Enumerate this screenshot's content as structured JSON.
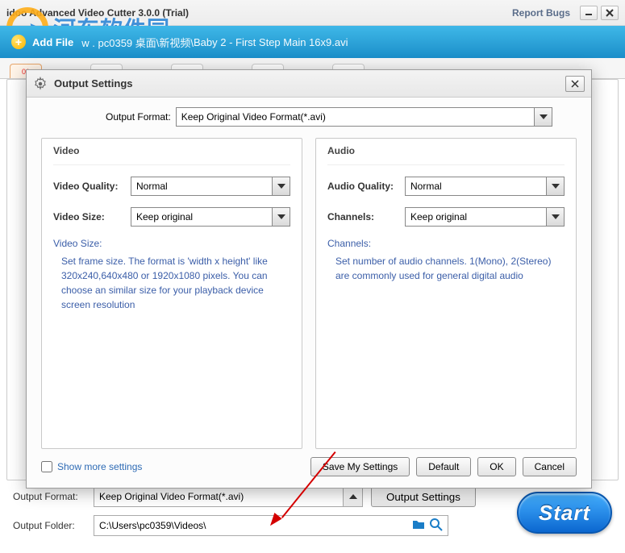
{
  "watermark": "河东软件园",
  "window": {
    "title": "idoo Advanced Video Cutter 3.0.0 (Trial)",
    "report_bugs": "Report Bugs"
  },
  "addfile": {
    "label": "Add File",
    "path_overlay": "w . pc0359 桌面\\新视频\\",
    "path": "Baby 2 - First Step Main 16x9.avi"
  },
  "dialog": {
    "title": "Output Settings",
    "output_format_label": "Output Format:",
    "output_format_value": "Keep Original Video Format(*.avi)",
    "video": {
      "legend": "Video",
      "quality_label": "Video Quality:",
      "quality_value": "Normal",
      "size_label": "Video Size:",
      "size_value": "Keep original",
      "hint_title": "Video Size:",
      "hint_text": "Set frame size. The format is 'width x height' like 320x240,640x480 or 1920x1080 pixels. You can choose an similar size for your playback device screen resolution"
    },
    "audio": {
      "legend": "Audio",
      "quality_label": "Audio Quality:",
      "quality_value": "Normal",
      "channels_label": "Channels:",
      "channels_value": "Keep original",
      "hint_title": "Channels:",
      "hint_text": "Set number of audio channels. 1(Mono), 2(Stereo) are commonly used for general digital audio"
    },
    "show_more": "Show more settings",
    "buttons": {
      "save": "Save My Settings",
      "default": "Default",
      "ok": "OK",
      "cancel": "Cancel"
    }
  },
  "bottom": {
    "output_format_label": "Output Format:",
    "output_format_value": "Keep Original Video Format(*.avi)",
    "output_settings_btn": "Output Settings",
    "output_folder_label": "Output Folder:",
    "output_folder_value": "C:\\Users\\pc0359\\Videos\\",
    "start": "Start"
  }
}
